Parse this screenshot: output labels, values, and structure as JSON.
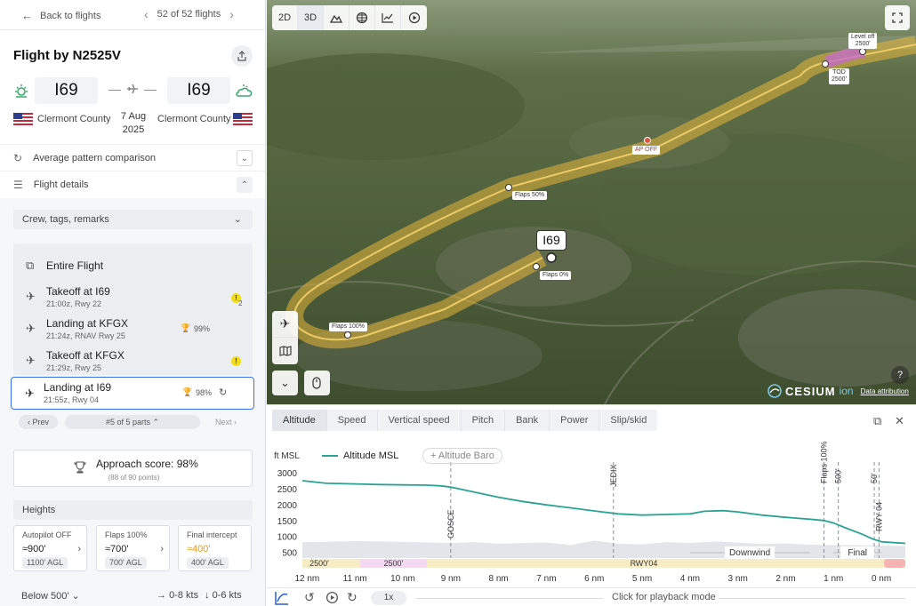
{
  "nav": {
    "back_label": "Back to flights",
    "pager_label": "52 of 52 flights"
  },
  "flight": {
    "title": "Flight by N2525V",
    "from_code": "I69",
    "to_code": "I69",
    "from_name": "Clermont County",
    "to_name": "Clermont County",
    "date_line1": "7 Aug",
    "date_line2": "2025"
  },
  "sections": {
    "pattern_label": "Average pattern comparison",
    "details_label": "Flight details",
    "crew_label": "Crew, tags, remarks"
  },
  "parts": {
    "entire_label": "Entire Flight",
    "items": [
      {
        "title": "Takeoff at I69",
        "sub": "21:00z, Rwy 22",
        "badge": "!",
        "badge_count": "2"
      },
      {
        "title": "Landing at KFGX",
        "sub": "21:24z, RNAV Rwy 25",
        "score": "99%"
      },
      {
        "title": "Takeoff at KFGX",
        "sub": "21:29z, Rwy 25",
        "badge": "!"
      },
      {
        "title": "Landing at I69",
        "sub": "21:55z, Rwy 04",
        "score": "98%"
      }
    ],
    "prev_label": "Prev",
    "position_label": "#5 of 5 parts",
    "next_label": "Next"
  },
  "approach": {
    "title": "Approach score: 98%",
    "sub": "(88 of 90 points)"
  },
  "heights": {
    "header": "Heights",
    "cards": [
      {
        "label": "Autopilot OFF",
        "value": "≈900'",
        "agl": "1100' AGL"
      },
      {
        "label": "Flaps 100%",
        "value": "≈700'",
        "agl": "700' AGL"
      },
      {
        "label": "Final intercept",
        "value": "≈400'",
        "agl": "400' AGL"
      }
    ]
  },
  "footer": {
    "below_label": "Below 500'",
    "kts_a": "0-8 kts",
    "kts_b": "0-6 kts"
  },
  "map": {
    "toolbar": [
      "2D",
      "3D"
    ],
    "airport_label": "I69",
    "labels": {
      "level_off": "Level off",
      "level_off_alt": "2500'",
      "tod": "TOD",
      "tod_alt": "2500'",
      "ap_off": "AP OFF",
      "flaps50": "Flaps 50%",
      "flaps0": "Flaps 0%",
      "flaps100": "Flaps 100%"
    },
    "brand": "CESIUM",
    "brand_suffix": "ion",
    "attribution": "Data attribution",
    "help": "?"
  },
  "chart_panel": {
    "tabs": [
      "Altitude",
      "Speed",
      "Vertical speed",
      "Pitch",
      "Bank",
      "Power",
      "Slip/skid"
    ],
    "active_tab": "Altitude",
    "legend_series": "Altitude MSL",
    "legend_add": "Altitude Baro",
    "speed": "1x",
    "playback_label": "Click for playback mode"
  },
  "chart_data": {
    "type": "line",
    "ylabel": "ft MSL",
    "xlabel": "",
    "x_ticks": [
      "12 nm",
      "11 nm",
      "10 nm",
      "9 nm",
      "8 nm",
      "7 nm",
      "6 nm",
      "5 nm",
      "4 nm",
      "3 nm",
      "2 nm",
      "1 nm",
      "0 nm"
    ],
    "y_ticks": [
      500,
      1000,
      1500,
      2000,
      2500,
      3000
    ],
    "xlim": [
      12.1,
      -0.5
    ],
    "ylim": [
      350,
      3200
    ],
    "series": [
      {
        "name": "Altitude MSL",
        "color": "#2aa394",
        "x": [
          12.1,
          11.6,
          11.0,
          10.5,
          10.0,
          9.5,
          9.2,
          9.0,
          8.5,
          8.0,
          7.5,
          7.0,
          6.5,
          6.0,
          5.5,
          5.0,
          4.5,
          4.0,
          3.7,
          3.3,
          3.0,
          2.5,
          2.0,
          1.5,
          1.2,
          1.0,
          0.7,
          0.4,
          0.2,
          0.0,
          -0.3,
          -0.5
        ],
        "y": [
          2780,
          2700,
          2680,
          2660,
          2650,
          2640,
          2620,
          2580,
          2420,
          2260,
          2130,
          2020,
          1930,
          1830,
          1740,
          1700,
          1720,
          1740,
          1820,
          1840,
          1800,
          1700,
          1630,
          1570,
          1530,
          1450,
          1270,
          1100,
          960,
          860,
          830,
          810
        ]
      }
    ],
    "terrain": {
      "x": [
        12.1,
        11.0,
        10.0,
        9.0,
        8.5,
        8.0,
        7.0,
        6.5,
        6.0,
        5.5,
        5.0,
        4.5,
        4.0,
        3.5,
        3.0,
        2.5,
        2.0,
        1.5,
        1.0,
        0.5,
        0.0,
        -0.5
      ],
      "y": [
        850,
        880,
        860,
        820,
        850,
        800,
        840,
        760,
        900,
        800,
        780,
        850,
        820,
        870,
        840,
        790,
        810,
        770,
        760,
        750,
        740,
        730
      ]
    },
    "annotations": [
      {
        "label": "GOSCE",
        "x": 9.0
      },
      {
        "label": "JEDIX",
        "x": 5.6
      },
      {
        "label": "Flaps 100%",
        "x": 1.2
      },
      {
        "label": "500'",
        "x": 0.9
      },
      {
        "label": "50'",
        "x": 0.15
      },
      {
        "label": "RWY 04",
        "x": 0.05
      }
    ],
    "phases": [
      {
        "label": "Downwind",
        "from": 4.0,
        "to": 1.5
      },
      {
        "label": "Final",
        "from": 1.0,
        "to": 0.0
      }
    ],
    "altitude_marks": [
      "2500'",
      "2500'",
      "RWY04"
    ]
  }
}
